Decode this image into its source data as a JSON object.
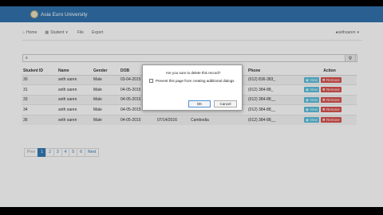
{
  "brand": {
    "title": "Asia Euro University"
  },
  "menu": {
    "home": "Home",
    "student": "Student",
    "file": "File",
    "export": "Export",
    "user": "sethsaren"
  },
  "search": {
    "value": "s"
  },
  "table": {
    "headers": [
      "Student ID",
      "Name",
      "Gender",
      "DOB",
      "",
      "",
      "",
      "Phone",
      "Action"
    ],
    "rows": [
      [
        "30",
        "seth saren",
        "Male",
        "03-04-2015",
        "",
        "",
        "",
        "(012) 836-383_"
      ],
      [
        "31",
        "seth saren",
        "Male",
        "04-05-2015",
        "",
        "",
        "",
        "(012) 384-88_"
      ],
      [
        "33",
        "seth saren",
        "Male",
        "04-05-2015",
        "",
        "",
        "",
        "(012) 384-88__"
      ],
      [
        "34",
        "seth saren",
        "Male",
        "04-05-2015",
        "07/14/2016",
        "Cambodia",
        "",
        "(012) 384-88__"
      ],
      [
        "36",
        "seth saren",
        "Male",
        "04-05-2015",
        "07/14/2016",
        "Cambodia",
        "",
        "(012) 384-88__"
      ]
    ],
    "view_label": "View",
    "remove_label": "Remove"
  },
  "pagination": [
    "Prev",
    "1",
    "2",
    "3",
    "4",
    "5",
    "6",
    "Next"
  ],
  "dialog": {
    "message": "Are you sure to delete this record?",
    "checkbox_label": "Prevent this page from creating additional dialogs",
    "ok_label": "OK",
    "cancel_label": "Cancel"
  },
  "colors": {
    "navbar": "#3173ad",
    "view_button": "#5bc0de",
    "remove_button": "#d9534f",
    "page_active": "#337ab7"
  },
  "icons": [
    "home-icon",
    "student-icon",
    "user-icon",
    "search-icon",
    "eye-icon",
    "trash-icon"
  ]
}
